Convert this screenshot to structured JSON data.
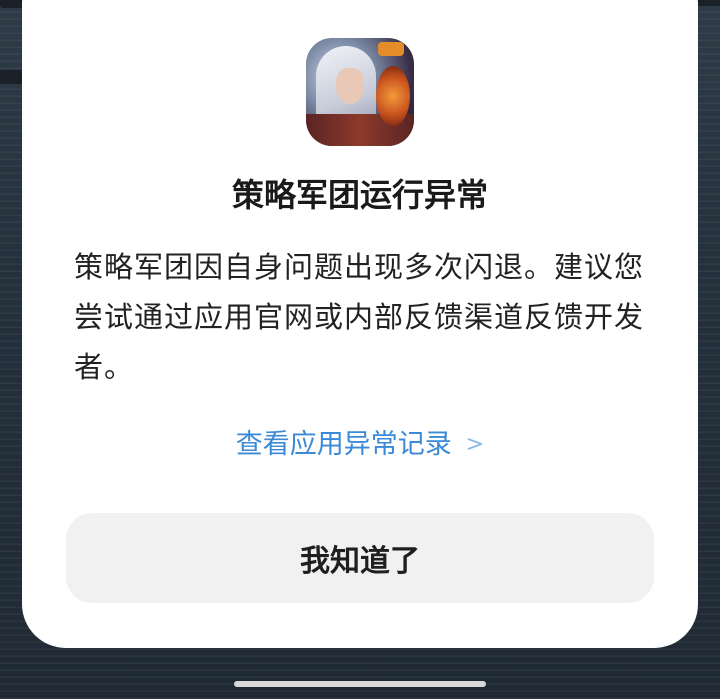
{
  "dialog": {
    "app_icon": "game-app-icon",
    "title": "策略军团运行异常",
    "message": "策略军团因自身问题出现多次闪退。建议您尝试通过应用官网或内部反馈渠道反馈开发者。",
    "link_label": "查看应用异常记录",
    "link_chevron": ">",
    "confirm_label": "我知道了"
  },
  "colors": {
    "link": "#3b8ad8",
    "button_bg": "#f1f1f1",
    "dialog_bg": "#ffffff"
  }
}
